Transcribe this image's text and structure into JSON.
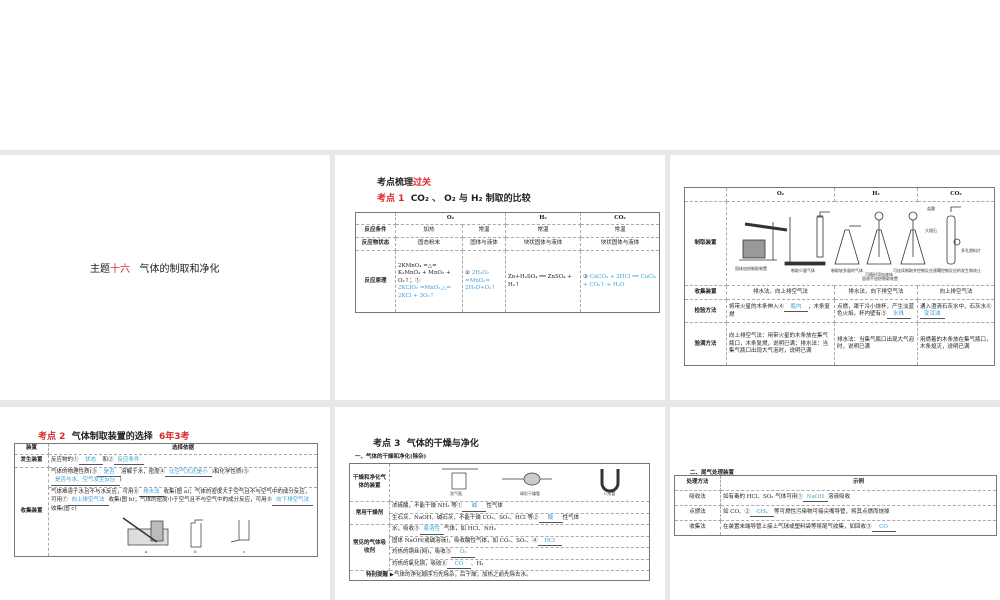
{
  "slide1": {
    "prefix": "主题",
    "num": "十六",
    "title": "气体的制取和净化"
  },
  "slide2": {
    "heading_black": "考点梳理",
    "heading_red": "过关",
    "topic_red": "考点 1",
    "topic": "CO₂ 、 O₂ 与 H₂ 制取的比较",
    "headers": [
      "O₂",
      "H₂",
      "CO₂"
    ],
    "rows": [
      {
        "label": "反应条件",
        "cells": [
          "加热",
          "常温",
          "常温",
          "常温"
        ]
      },
      {
        "label": "反应物状态",
        "cells": [
          "固态粉末",
          "固体与液体",
          "块状固体与液体",
          "块状固体与液体"
        ]
      },
      {
        "label": "反应原理",
        "cells": [
          "2KMnO₄ =△= K₂MnO₄ + MnO₂ + O₂↑；①",
          "2KClO₃ =MnO₂,△= 2KCl + 3O₂↑",
          "②",
          "2H₂O₂ =MnO₂= 2H₂O+O₂↑",
          "Zn+H₂SO₄ ══ ZnSO₄ + H₂↑",
          "③",
          "CaCO₃ + 2HCl ══ CaCl₂ + CO₂↑ + H₂O"
        ]
      }
    ]
  },
  "slide3": {
    "headers": [
      "O₂",
      "H₂",
      "CO₂"
    ],
    "device_label": "制取装置",
    "captions": [
      "固体加热制取装置",
      "制取少量气体",
      "制取较多量的气体",
      "可随时添加液体",
      "可连续制取并控制反应速率",
      "可控制反应的发生和终止",
      "固液不加热制取装置"
    ],
    "co2_labels": [
      "盐酸",
      "大理石",
      "多孔塑料片"
    ],
    "rows": [
      {
        "label": "收集装置",
        "cells": [
          "排水法，向上排空气法",
          "排水法，向下排空气法",
          "向上排空气法"
        ]
      },
      {
        "label": "检验方法",
        "cells": [
          "将带火星的木条伸入④",
          "，木条复燃",
          "点燃，罩干冷小烧杯，产生淡蓝色火焰，杯内壁有⑤",
          "通入澄清石灰水中，石灰水⑥"
        ]
      },
      {
        "label": "验满方法",
        "cells": [
          "向上排空气法：用带火星的木条放在集气瓶口，木条复燃，说明已满；排水法：当集气瓶口出现大气泡时，说明已满",
          "排水法：当集气瓶口出现大气泡时，说明已满",
          "用燃着的木条放在集气瓶口，木条熄灭，说明已满"
        ]
      }
    ],
    "answers": [
      "瓶内",
      "水珠",
      "变浑浊"
    ]
  },
  "slide4": {
    "topic_red": "考点 2",
    "topic": "气体制取装置的选择",
    "badge": "6年3考",
    "headers": [
      "装置",
      "选择依据"
    ],
    "gen_label": "发生装置",
    "gen_text": [
      "反应物的①",
      "和②"
    ],
    "gen_answers": [
      "状态",
      "反应条件"
    ],
    "col_label": "收集装置",
    "col_text1": [
      "气体的物理性质(③",
      "溶解于水，密度④",
      ")和化学性质(⑤",
      ")"
    ],
    "col_answers1": [
      "是否",
      "比空气大还是小",
      "是否与水、空气发生反应"
    ],
    "col_text2": [
      "气体难溶于水且不与水反应，可用⑥",
      "收集(图 a)；气体的密度大于空气且不与空气中的成分反应，可用⑦",
      "收集(图 b)；气体的密度小于空气且不与空气中的成分反应，可用⑧",
      "收集(图 c)"
    ],
    "col_answers2": [
      "排水法",
      "向上排空气法",
      "向下排空气法"
    ],
    "fig_labels": [
      "a",
      "b",
      "c"
    ]
  },
  "slide5": {
    "topic_red": "考点 3",
    "topic": "气体的干燥与净化",
    "sub": "一、气体的干燥和净化(除杂)",
    "device_label": "干燥和净化气体的装置",
    "device_captions": [
      "洗气瓶",
      "球形干燥管",
      "U形管"
    ],
    "drying_label": "常用干燥剂",
    "drying": [
      {
        "text": [
          "浓硫酸，不能干燥 NH₃ 等①",
          "性气体"
        ],
        "ans": "碱"
      },
      {
        "text": [
          "生石灰、NaOH、碱石灰，不能干燥 CO₂、SO₂、HCl 等②",
          "性气体"
        ],
        "ans": "酸"
      }
    ],
    "absorb_label": "常见的气体吸收剂",
    "absorb": [
      {
        "text": [
          "水，吸收③",
          "气体，如 HCl、NH₃"
        ],
        "ans": "易溶性"
      },
      {
        "text": [
          "固体 NaOH(或碱溶液)，吸收酸性气体，如 CO₂、SO₂、④",
          ""
        ],
        "ans": "HCl"
      },
      {
        "text": [
          "灼热的铜丝(网)，吸收⑤",
          ""
        ],
        "ans": "O₂"
      },
      {
        "text": [
          "灼热的氧化铜，吸收⑥",
          "、H₂"
        ],
        "ans": "CO"
      }
    ],
    "tip_label": "特别提醒",
    "tip": "气体的净化顺序为先除杂，后干燥；加热之前先除去水。"
  },
  "slide6": {
    "sub": "二、尾气处理装置",
    "headers": [
      "处理方法",
      "示例"
    ],
    "rows": [
      {
        "label": "吸收法",
        "text": [
          "如有毒的 HCl、SO₂ 气体可用①",
          "溶液吸收"
        ],
        "ans": "NaOH"
      },
      {
        "label": "点燃法",
        "text": [
          "如 CO、②",
          "等可燃性污染物可接尖嘴导管，将其点燃而烧掉"
        ],
        "ans": "CH₄"
      },
      {
        "label": "收集法",
        "text": [
          "在装置末端导管上接上气球或塑料袋等将尾气收集，如回收③",
          ""
        ],
        "ans": "CO"
      }
    ]
  },
  "colors": {
    "red": "#d9262b",
    "answer": "#3a9fd6"
  }
}
